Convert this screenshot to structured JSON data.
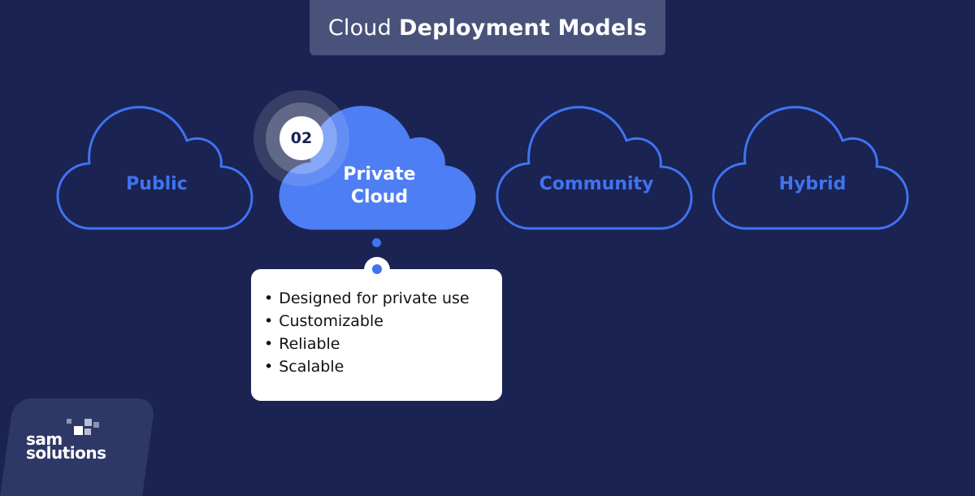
{
  "title": {
    "regular": "Cloud",
    "bold": "Deployment Models"
  },
  "models": [
    {
      "label": "Public",
      "selected": false
    },
    {
      "label": "Private Cloud",
      "label_line1": "Private",
      "label_line2": "Cloud",
      "selected": true
    },
    {
      "label": "Community",
      "selected": false
    },
    {
      "label": "Hybrid",
      "selected": false
    }
  ],
  "selected_badge": "02",
  "details": {
    "items": [
      "Designed for private use",
      "Customizable",
      "Reliable",
      "Scalable"
    ]
  },
  "logo": {
    "line1": "sam",
    "line2": "solutions"
  },
  "colors": {
    "background": "#1a2351",
    "accent": "#3f73f0",
    "selected_fill": "#4d7ef3",
    "title_box": "#48527a"
  }
}
